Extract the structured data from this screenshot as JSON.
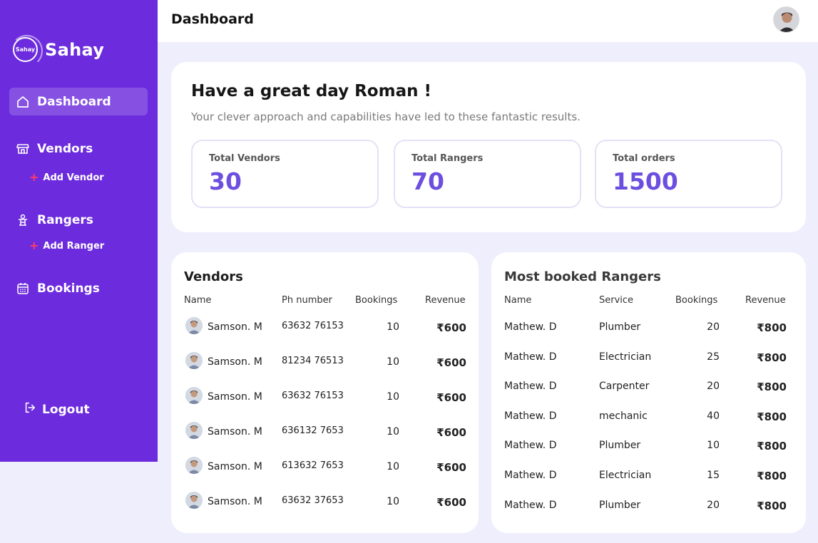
{
  "brand": {
    "name": "Sahay",
    "logo_text": "Sahay"
  },
  "header": {
    "title": "Dashboard"
  },
  "sidebar": {
    "items": [
      {
        "label": "Dashboard"
      },
      {
        "label": "Vendors"
      },
      {
        "label": "Add Vendor"
      },
      {
        "label": "Rangers"
      },
      {
        "label": "Add Ranger"
      },
      {
        "label": "Bookings"
      }
    ],
    "logout": "Logout"
  },
  "welcome": {
    "title": "Have a great day Roman !",
    "subtitle": "Your clever approach and capabilities have led to these fantastic results.",
    "stats": [
      {
        "label": "Total  Vendors",
        "value": "30"
      },
      {
        "label": "Total  Rangers",
        "value": "70"
      },
      {
        "label": "Total orders",
        "value": "1500"
      }
    ]
  },
  "vendors": {
    "title": "Vendors",
    "columns": [
      "Name",
      "Ph number",
      "Bookings",
      "Revenue"
    ],
    "rows": [
      {
        "name": "Samson. M",
        "phone": "63632 76153",
        "bookings": "10",
        "revenue": "₹600"
      },
      {
        "name": "Samson. M",
        "phone": "81234 76513",
        "bookings": "10",
        "revenue": "₹600"
      },
      {
        "name": "Samson. M",
        "phone": "63632 76153",
        "bookings": "10",
        "revenue": "₹600"
      },
      {
        "name": "Samson. M",
        "phone": "636132 7653",
        "bookings": "10",
        "revenue": "₹600"
      },
      {
        "name": "Samson. M",
        "phone": "613632 7653",
        "bookings": "10",
        "revenue": "₹600"
      },
      {
        "name": "Samson. M",
        "phone": "63632 37653",
        "bookings": "10",
        "revenue": "₹600"
      }
    ]
  },
  "rangers": {
    "title": "Most booked Rangers",
    "columns": [
      "Name",
      "Service",
      "Bookings",
      "Revenue"
    ],
    "rows": [
      {
        "name": "Mathew. D",
        "service": "Plumber",
        "bookings": "20",
        "revenue": "₹800"
      },
      {
        "name": "Mathew. D",
        "service": "Electrician",
        "bookings": "25",
        "revenue": "₹800"
      },
      {
        "name": "Mathew. D",
        "service": "Carpenter",
        "bookings": "20",
        "revenue": "₹800"
      },
      {
        "name": "Mathew. D",
        "service": "mechanic",
        "bookings": "40",
        "revenue": "₹800"
      },
      {
        "name": "Mathew. D",
        "service": "Plumber",
        "bookings": "10",
        "revenue": "₹800"
      },
      {
        "name": "Mathew. D",
        "service": "Electrician",
        "bookings": "15",
        "revenue": "₹800"
      },
      {
        "name": "Mathew. D",
        "service": "Plumber",
        "bookings": "20",
        "revenue": "₹800"
      }
    ]
  },
  "colors": {
    "sidebar_bg": "#6C2BDD",
    "accent": "#6D4FE0",
    "page_bg": "#EFEEFC",
    "plus_red": "#FF3D68"
  },
  "icons": [
    "home-icon",
    "store-icon",
    "plus-icon",
    "ranger-icon",
    "calendar-icon",
    "logout-icon",
    "user-avatar-icon"
  ]
}
